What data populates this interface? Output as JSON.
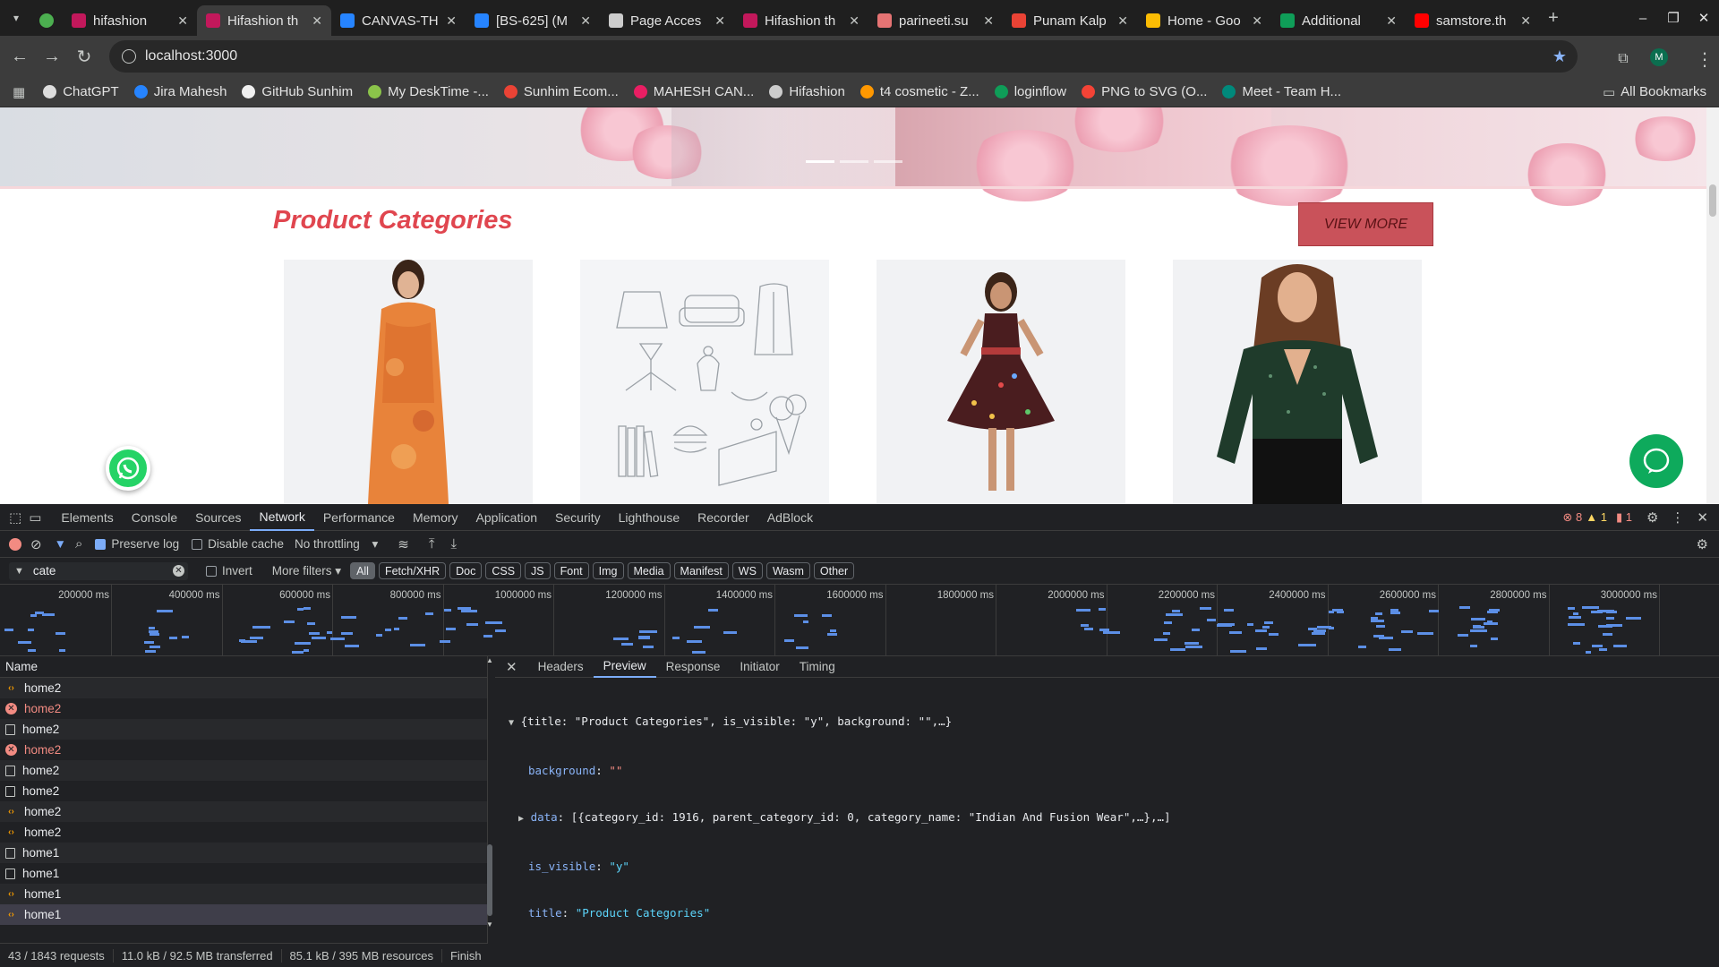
{
  "tabs": [
    {
      "label": "",
      "icon": "tab-group-icon",
      "color": "#4caf50"
    },
    {
      "label": "hifashion",
      "icon": "hifashion-icon",
      "color": "#c2185b"
    },
    {
      "label": "Hifashion th",
      "icon": "hifashion-icon",
      "color": "#c2185b",
      "active": true
    },
    {
      "label": "CANVAS-TH",
      "icon": "jira-icon",
      "color": "#2684ff"
    },
    {
      "label": "[BS-625] (M",
      "icon": "jira-icon",
      "color": "#2684ff"
    },
    {
      "label": "Page Acces",
      "icon": "chatgpt-icon",
      "color": "#cccccc"
    },
    {
      "label": "Hifashion th",
      "icon": "hifashion-icon",
      "color": "#c2185b"
    },
    {
      "label": "parineeti.su",
      "icon": "image-icon",
      "color": "#e57373"
    },
    {
      "label": "Punam Kalp",
      "icon": "gmail-icon",
      "color": "#ea4335"
    },
    {
      "label": "Home - Goo",
      "icon": "drive-icon",
      "color": "#fbbc04"
    },
    {
      "label": "Additional",
      "icon": "sheets-icon",
      "color": "#0f9d58"
    },
    {
      "label": "samstore.th",
      "icon": "youtube-icon",
      "color": "#ff0000"
    }
  ],
  "address": {
    "url": "localhost:3000",
    "profile": "M"
  },
  "bookmarks": [
    {
      "label": "ChatGPT",
      "color": "#dddddd"
    },
    {
      "label": "Jira Mahesh",
      "color": "#2684ff"
    },
    {
      "label": "GitHub Sunhim",
      "color": "#f0f0f0"
    },
    {
      "label": "My DeskTime -...",
      "color": "#8bc34a"
    },
    {
      "label": "Sunhim Ecom...",
      "color": "#ea4335"
    },
    {
      "label": "MAHESH CAN...",
      "color": "#e91e63"
    },
    {
      "label": "Hifashion",
      "color": "#cccccc"
    },
    {
      "label": "t4 cosmetic - Z...",
      "color": "#ff9800"
    },
    {
      "label": "loginflow",
      "color": "#0f9d58"
    },
    {
      "label": "PNG to SVG (O...",
      "color": "#f44336"
    },
    {
      "label": "Meet - Team H...",
      "color": "#00897b"
    }
  ],
  "all_bookmarks": "All Bookmarks",
  "page": {
    "section_title": "Product Categories",
    "view_more": "VIEW MORE"
  },
  "devtools": {
    "tabs": [
      "Elements",
      "Console",
      "Sources",
      "Network",
      "Performance",
      "Memory",
      "Application",
      "Security",
      "Lighthouse",
      "Recorder",
      "AdBlock"
    ],
    "active_tab": "Network",
    "errors": "8",
    "warnings": "1",
    "issues": "1",
    "preserve_log": "Preserve log",
    "disable_cache": "Disable cache",
    "throttling": "No throttling",
    "filter_value": "cate",
    "invert": "Invert",
    "more_filters": "More filters",
    "filter_chips": [
      "All",
      "Fetch/XHR",
      "Doc",
      "CSS",
      "JS",
      "Font",
      "Img",
      "Media",
      "Manifest",
      "WS",
      "Wasm",
      "Other"
    ],
    "timeline_labels": [
      "200000 ms",
      "400000 ms",
      "600000 ms",
      "800000 ms",
      "1000000 ms",
      "1200000 ms",
      "1400000 ms",
      "1600000 ms",
      "1800000 ms",
      "2000000 ms",
      "2200000 ms",
      "2400000 ms",
      "2600000 ms",
      "2800000 ms",
      "3000000 ms"
    ],
    "name_header": "Name",
    "requests": [
      {
        "name": "home2",
        "type": "xhr"
      },
      {
        "name": "home2",
        "type": "error"
      },
      {
        "name": "home2",
        "type": "doc"
      },
      {
        "name": "home2",
        "type": "error"
      },
      {
        "name": "home2",
        "type": "doc"
      },
      {
        "name": "home2",
        "type": "doc"
      },
      {
        "name": "home2",
        "type": "xhr"
      },
      {
        "name": "home2",
        "type": "xhr"
      },
      {
        "name": "home1",
        "type": "doc"
      },
      {
        "name": "home1",
        "type": "doc"
      },
      {
        "name": "home1",
        "type": "xhr"
      },
      {
        "name": "home1",
        "type": "xhr",
        "selected": true
      }
    ],
    "preview_tabs": [
      "Headers",
      "Preview",
      "Response",
      "Initiator",
      "Timing"
    ],
    "active_preview_tab": "Preview",
    "preview": {
      "summary": "{title: \"Product Categories\", is_visible: \"y\", background: \"\",…}",
      "background_key": "background",
      "background_val": "\"\"",
      "data_key": "data",
      "data_val": "[{category_id: 1916, parent_category_id: 0, category_name: \"Indian And Fusion Wear\",…},…]",
      "is_visible_key": "is_visible",
      "is_visible_val": "\"y\"",
      "title_key": "title",
      "title_val": "\"Product Categories\""
    },
    "status": {
      "requests": "43 / 1843 requests",
      "transferred": "11.0 kB / 92.5 MB transferred",
      "resources": "85.1 kB / 395 MB resources",
      "finish": "Finish"
    }
  }
}
